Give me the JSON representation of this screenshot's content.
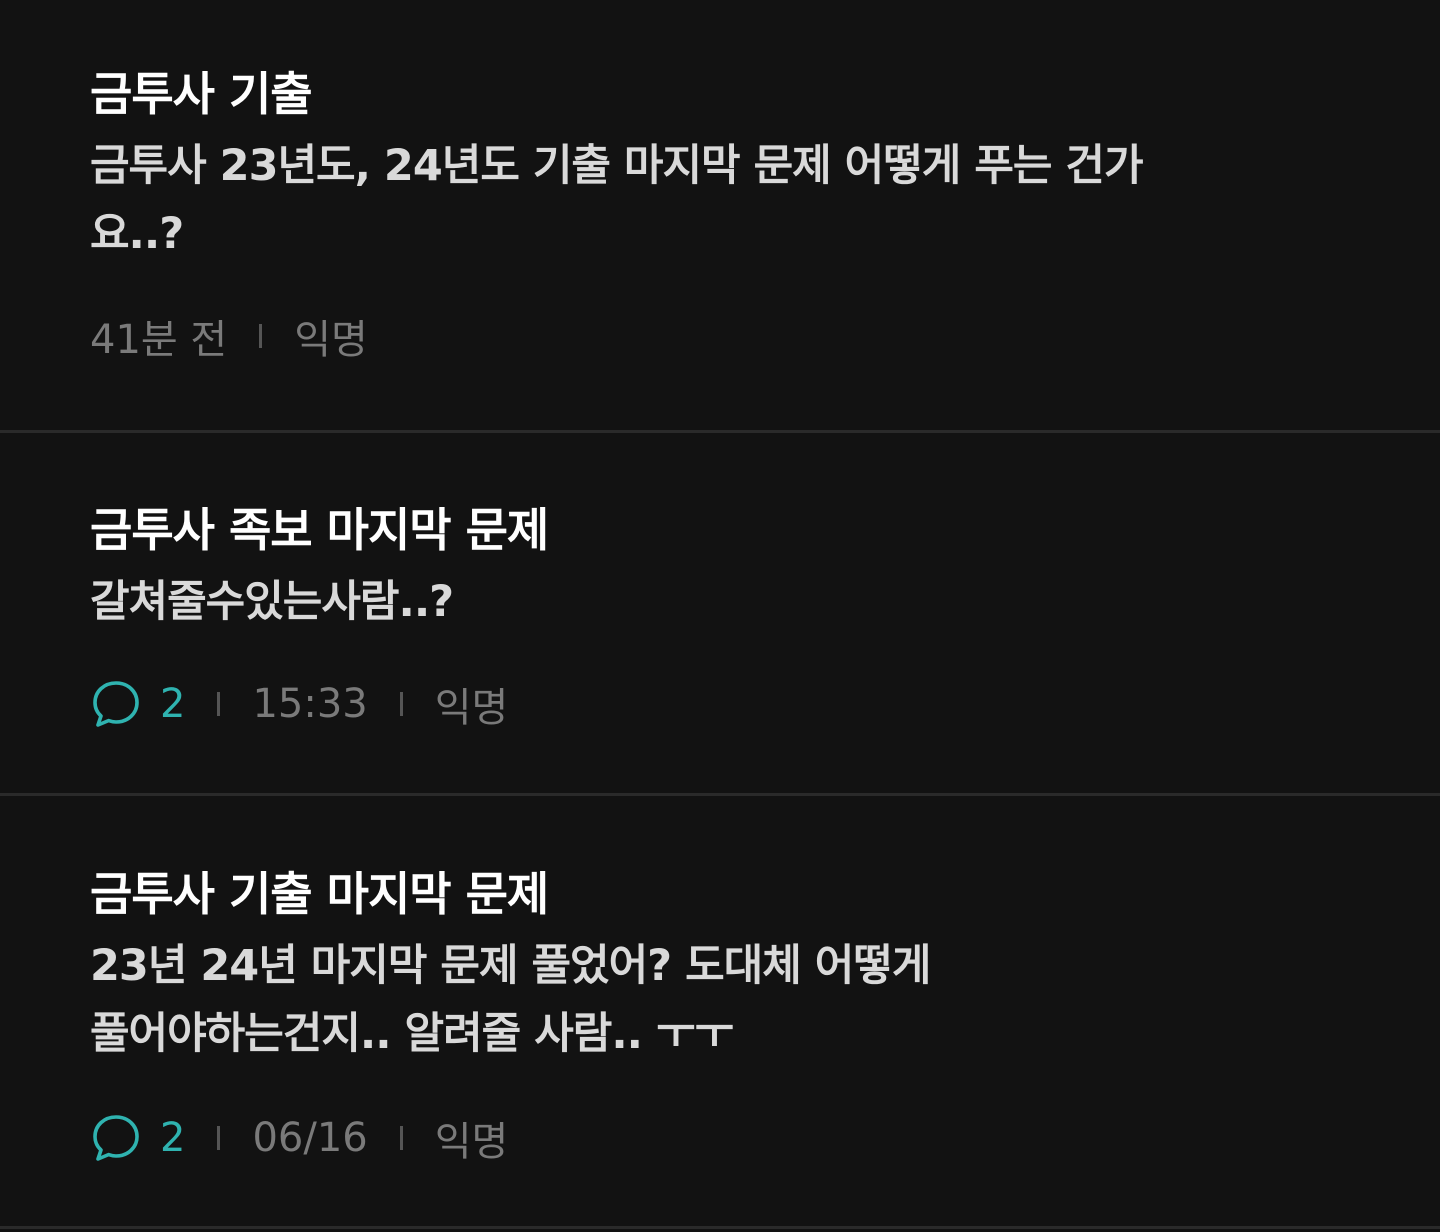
{
  "posts": [
    {
      "title": "금투사 기출",
      "body": "금투사 23년도, 24년도 기출 마지막 문제 어떻게 푸는 건가요..?",
      "time": "41분 전",
      "author": "익명"
    },
    {
      "title": "금투사 족보 마지막 문제",
      "body": "갈쳐줄수있는사람..?",
      "comments": "2",
      "time": "15:33",
      "author": "익명"
    },
    {
      "title": "금투사 기출 마지막 문제",
      "body_line1": "23년 24년 마지막 문제 풀었어? 도대체 어떻게",
      "body_line2": "풀어야하는건지.. 알려줄 사람.. ㅜㅜ",
      "comments": "2",
      "time": "06/16",
      "author": "익명"
    }
  ],
  "colors": {
    "background": "#121212",
    "accent": "#2fb3b0",
    "meta": "#7a7a7a"
  },
  "icons": {
    "comment": "comment-bubble-icon"
  }
}
